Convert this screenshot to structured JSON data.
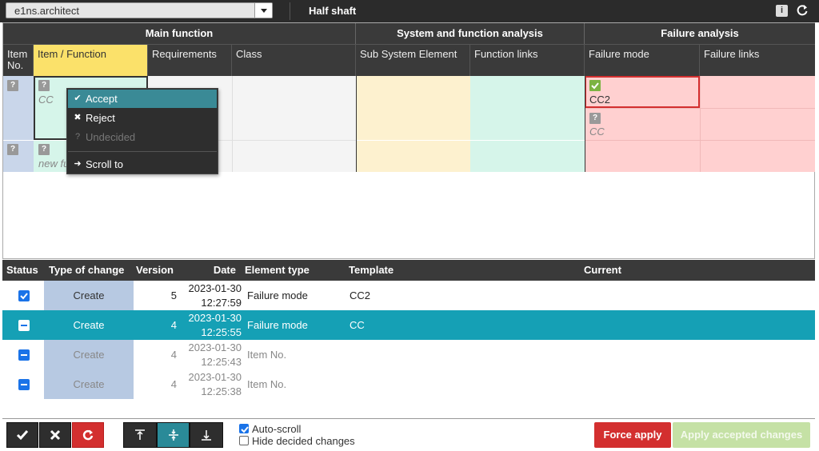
{
  "topbar": {
    "app_selector_value": "e1ns.architect",
    "title": "Half shaft",
    "info_label": "i"
  },
  "grid": {
    "groups": {
      "main_function": "Main function",
      "system_function_analysis": "System and function analysis",
      "failure_analysis": "Failure analysis"
    },
    "columns": {
      "item_no": "Item No.",
      "item_function": "Item / Function",
      "requirements": "Requirements",
      "class": "Class",
      "sub_system_element": "Sub System Element",
      "function_links": "Function links",
      "failure_mode": "Failure mode",
      "failure_links": "Failure links"
    },
    "badge_undecided": "?",
    "row1_function_text": "CC",
    "row2_function_text": "new fu",
    "failure_mode_accepted": "CC2",
    "failure_mode_undecided": "CC"
  },
  "context_menu": {
    "accept": "Accept",
    "reject": "Reject",
    "undecided": "Undecided",
    "scroll_to": "Scroll to"
  },
  "changes_table": {
    "headers": {
      "status": "Status",
      "type_of_change": "Type of change",
      "version": "Version",
      "date": "Date",
      "element_type": "Element type",
      "template": "Template",
      "current": "Current"
    },
    "rows": [
      {
        "type": "Create",
        "version": "5",
        "date": "2023-01-30",
        "time": "12:27:59",
        "element_type": "Failure mode",
        "template": "CC2",
        "current": ""
      },
      {
        "type": "Create",
        "version": "4",
        "date": "2023-01-30",
        "time": "12:25:55",
        "element_type": "Failure mode",
        "template": "CC",
        "current": ""
      },
      {
        "type": "Create",
        "version": "4",
        "date": "2023-01-30",
        "time": "12:25:43",
        "element_type": "Item No.",
        "template": "",
        "current": ""
      },
      {
        "type": "Create",
        "version": "4",
        "date": "2023-01-30",
        "time": "12:25:38",
        "element_type": "Item No.",
        "template": "",
        "current": ""
      }
    ]
  },
  "bottom": {
    "auto_scroll": "Auto-scroll",
    "hide_decided": "Hide decided changes",
    "force_apply": "Force apply",
    "apply_accepted": "Apply accepted changes"
  },
  "colors": {
    "accent": "#15a0b5",
    "danger": "#d32f2f",
    "success_disabled": "#c5e1a5",
    "header_active": "#fbe16a"
  }
}
